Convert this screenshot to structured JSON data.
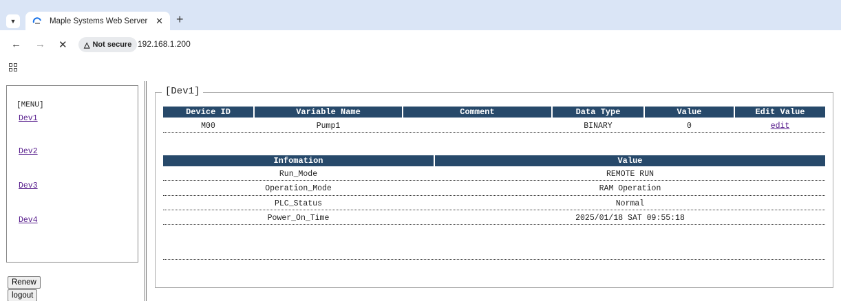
{
  "browser": {
    "tab_title": "Maple Systems Web Server",
    "security_label": "Not secure",
    "url": "192.168.1.200"
  },
  "menu": {
    "title": "[MENU]",
    "items": [
      "Dev1",
      "Dev2",
      "Dev3",
      "Dev4"
    ]
  },
  "buttons": {
    "renew": "Renew",
    "logout": "logout"
  },
  "panel": {
    "legend": "[Dev1]",
    "device_table": {
      "headers": [
        "Device ID",
        "Variable Name",
        "Comment",
        "Data Type",
        "Value",
        "Edit Value"
      ],
      "rows": [
        {
          "device_id": "M00",
          "variable_name": "Pump1",
          "comment": "",
          "data_type": "BINARY",
          "value": "0",
          "edit": "edit"
        }
      ]
    },
    "info_table": {
      "headers": [
        "Infomation",
        "Value"
      ],
      "rows": [
        {
          "info": "Run_Mode",
          "value": "REMOTE RUN"
        },
        {
          "info": "Operation_Mode",
          "value": "RAM Operation"
        },
        {
          "info": "PLC_Status",
          "value": "Normal"
        },
        {
          "info": "Power_On_Time",
          "value": "2025/01/18 SAT 09:55:18"
        }
      ]
    }
  },
  "colors": {
    "header_bg": "#27496a",
    "tabstrip_bg": "#dae5f6",
    "visited_link": "#551a8b"
  }
}
